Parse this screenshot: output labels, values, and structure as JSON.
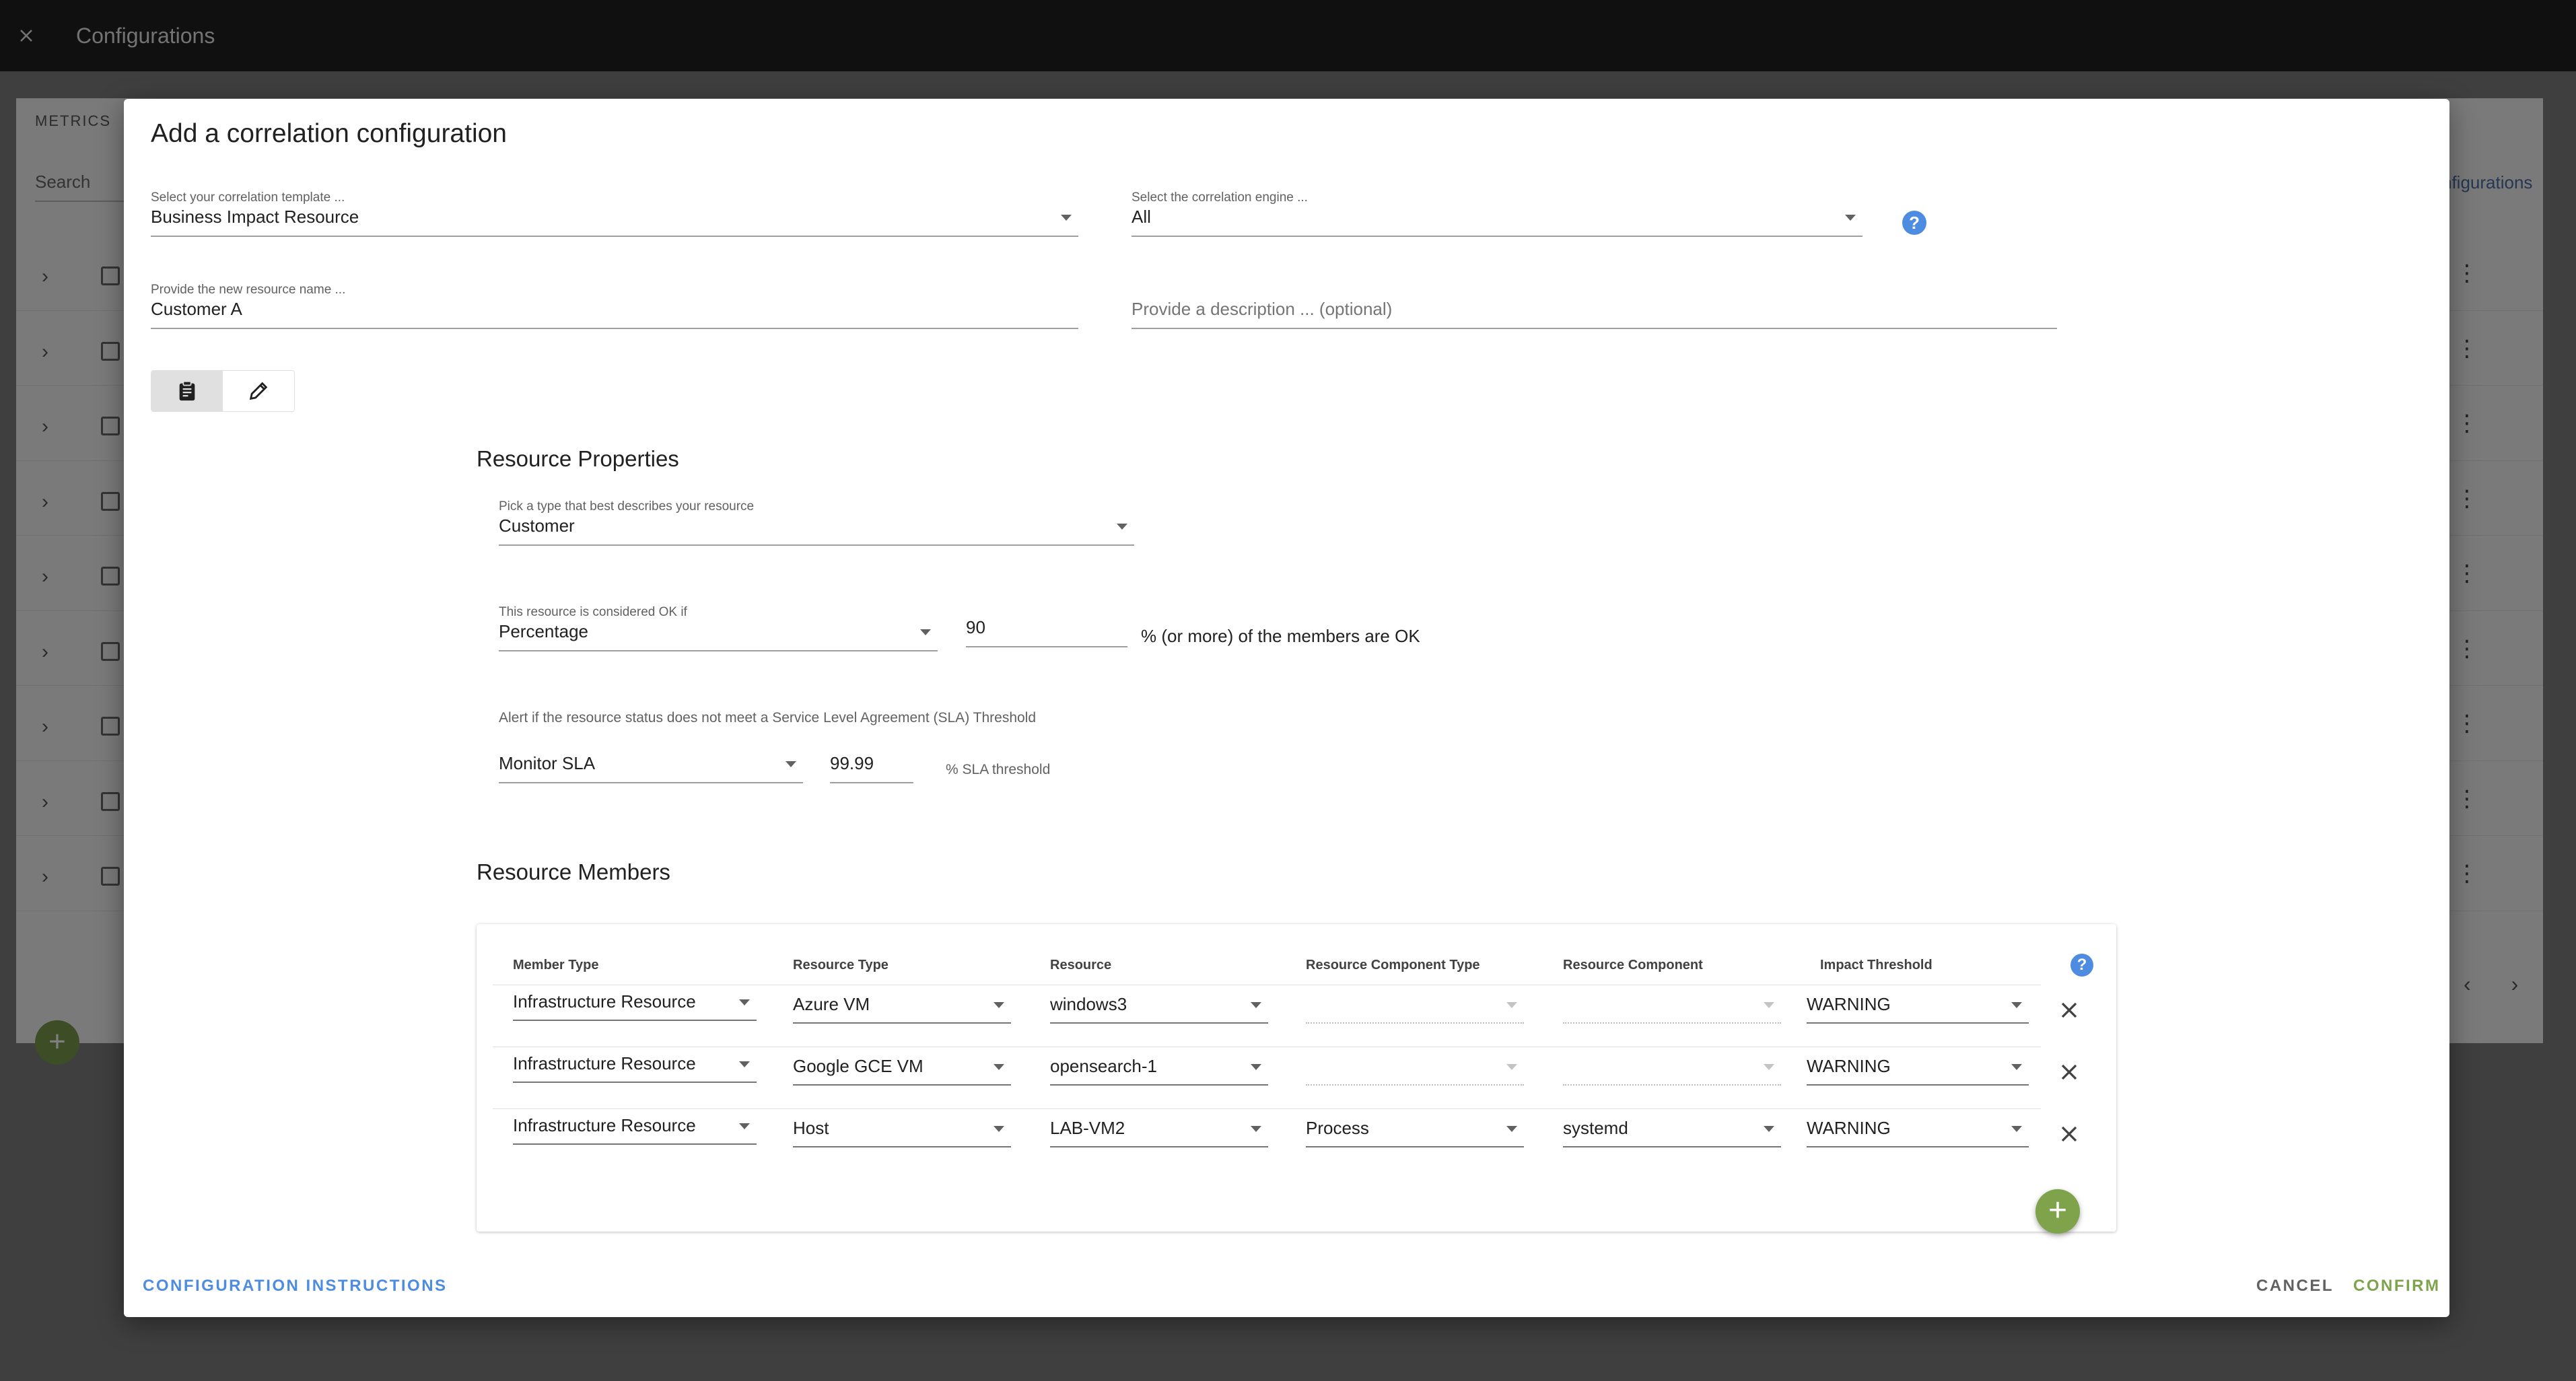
{
  "app": {
    "title": "Configurations"
  },
  "background": {
    "metrics_label": "METRICS",
    "search_placeholder": "Search",
    "configurations_link": "nfigurations",
    "row_count": 9
  },
  "dialog": {
    "title": "Add a correlation configuration",
    "template": {
      "label": "Select your correlation template ...",
      "value": "Business Impact Resource"
    },
    "engine": {
      "label": "Select the correlation engine ...",
      "value": "All"
    },
    "resource_name": {
      "label": "Provide the new resource name ...",
      "value": "Customer A"
    },
    "description": {
      "placeholder": "Provide a description ... (optional)"
    },
    "properties": {
      "title": "Resource Properties",
      "type": {
        "label": "Pick a type that best describes your resource",
        "value": "Customer"
      },
      "ok_rule": {
        "label": "This resource is considered OK if",
        "mode": "Percentage",
        "threshold": "90",
        "suffix": "% (or more) of the members are OK"
      },
      "sla": {
        "note": "Alert if the resource status does not meet a Service Level Agreement (SLA) Threshold",
        "mode": "Monitor SLA",
        "threshold": "99.99",
        "suffix": "% SLA threshold"
      }
    },
    "members": {
      "title": "Resource Members",
      "columns": [
        "Member Type",
        "Resource Type",
        "Resource",
        "Resource Component Type",
        "Resource Component",
        "Impact Threshold"
      ],
      "rows": [
        {
          "member_type": "Infrastructure Resource",
          "resource_type": "Azure VM",
          "resource": "windows3",
          "component_type": "",
          "component": "",
          "impact": "WARNING"
        },
        {
          "member_type": "Infrastructure Resource",
          "resource_type": "Google GCE VM",
          "resource": "opensearch-1",
          "component_type": "",
          "component": "",
          "impact": "WARNING"
        },
        {
          "member_type": "Infrastructure Resource",
          "resource_type": "Host",
          "resource": "LAB-VM2",
          "component_type": "Process",
          "component": "systemd",
          "impact": "WARNING"
        }
      ]
    },
    "actions": {
      "instructions": "CONFIGURATION INSTRUCTIONS",
      "cancel": "CANCEL",
      "confirm": "CONFIRM"
    }
  },
  "colors": {
    "accent_blue": "#4d8ce0",
    "accent_green": "#7fa34b",
    "appbar": "#212121"
  }
}
